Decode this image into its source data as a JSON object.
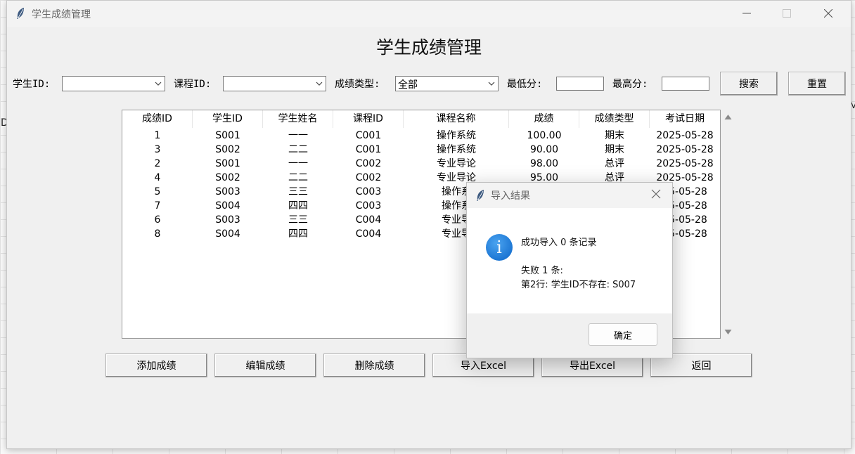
{
  "window": {
    "title": "学生成绩管理",
    "controls": [
      "minimize-icon",
      "maximize-icon",
      "close-icon"
    ]
  },
  "page": {
    "heading": "学生成绩管理"
  },
  "filters": {
    "student_id_label": "学生ID:",
    "student_id_value": "",
    "course_id_label": "课程ID:",
    "course_id_value": "",
    "grade_type_label": "成绩类型:",
    "grade_type_value": "全部",
    "min_score_label": "最低分:",
    "min_score_value": "",
    "max_score_label": "最高分:",
    "max_score_value": "",
    "search_button": "搜索",
    "reset_button": "重置"
  },
  "table": {
    "columns": [
      "成绩ID",
      "学生ID",
      "学生姓名",
      "课程ID",
      "课程名称",
      "成绩",
      "成绩类型",
      "考试日期"
    ],
    "rows": [
      [
        "1",
        "S001",
        "一一",
        "C001",
        "操作系统",
        "100.00",
        "期末",
        "2025-05-28"
      ],
      [
        "3",
        "S002",
        "二二",
        "C001",
        "操作系统",
        "90.00",
        "期末",
        "2025-05-28"
      ],
      [
        "2",
        "S001",
        "一一",
        "C002",
        "专业导论",
        "98.00",
        "总评",
        "2025-05-28"
      ],
      [
        "4",
        "S002",
        "二二",
        "C002",
        "专业导论",
        "95.00",
        "总评",
        "2025-05-28"
      ],
      [
        "5",
        "S003",
        "三三",
        "C003",
        "操作系",
        "",
        "",
        "25-05-28"
      ],
      [
        "7",
        "S004",
        "四四",
        "C003",
        "操作系",
        "",
        "",
        "25-05-28"
      ],
      [
        "6",
        "S003",
        "三三",
        "C004",
        "专业导",
        "",
        "",
        "25-05-28"
      ],
      [
        "8",
        "S004",
        "四四",
        "C004",
        "专业导",
        "",
        "",
        "25-05-28"
      ]
    ]
  },
  "actions": {
    "add": "添加成绩",
    "edit": "编辑成绩",
    "delete": "删除成绩",
    "import": "导入Excel",
    "export": "导出Excel",
    "back": "返回"
  },
  "dialog": {
    "title": "导入结果",
    "line1": "成功导入 0 条记录",
    "line2": "失败 1 条:",
    "line3": "第2行: 学生ID不存在: S007",
    "ok_button": "确定",
    "icon": "info-icon"
  },
  "background": {
    "left_glyph": "D",
    "right_glyph": "M"
  },
  "colors": {
    "accent": "#0a64c8",
    "window_bg": "#f0f0f0",
    "table_bg": "#ffffff"
  }
}
